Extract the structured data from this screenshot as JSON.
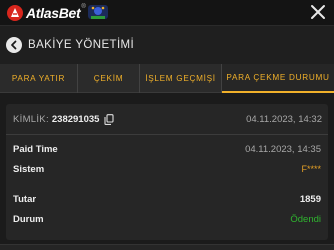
{
  "brand": {
    "name_part1": "Atlas",
    "name_part2": "Bet",
    "tm": "®"
  },
  "header": {
    "title": "BAKİYE YÖNETİMİ"
  },
  "tabs": [
    {
      "label": "PARA YATIR"
    },
    {
      "label": "ÇEKİM"
    },
    {
      "label": "İŞLEM GEÇMİŞİ"
    },
    {
      "label": "PARA ÇEKME DURUMU",
      "active": true
    }
  ],
  "transaction": {
    "id_label": "KİMLİK:",
    "id_value": "238291035",
    "created": "04.11.2023, 14:32",
    "paid_time_label": "Paid Time",
    "paid_time_value": "04.11.2023, 14:35",
    "system_label": "Sistem",
    "system_value": "F****",
    "amount_label": "Tutar",
    "amount_value": "1859",
    "status_label": "Durum",
    "status_value": "Ödendi"
  },
  "colors": {
    "accent": "#f0b02a",
    "success": "#2fb52f",
    "background": "#1b1b1b"
  },
  "icons": {
    "close": "close-icon",
    "back": "arrow-left-icon",
    "copy": "copy-icon"
  }
}
